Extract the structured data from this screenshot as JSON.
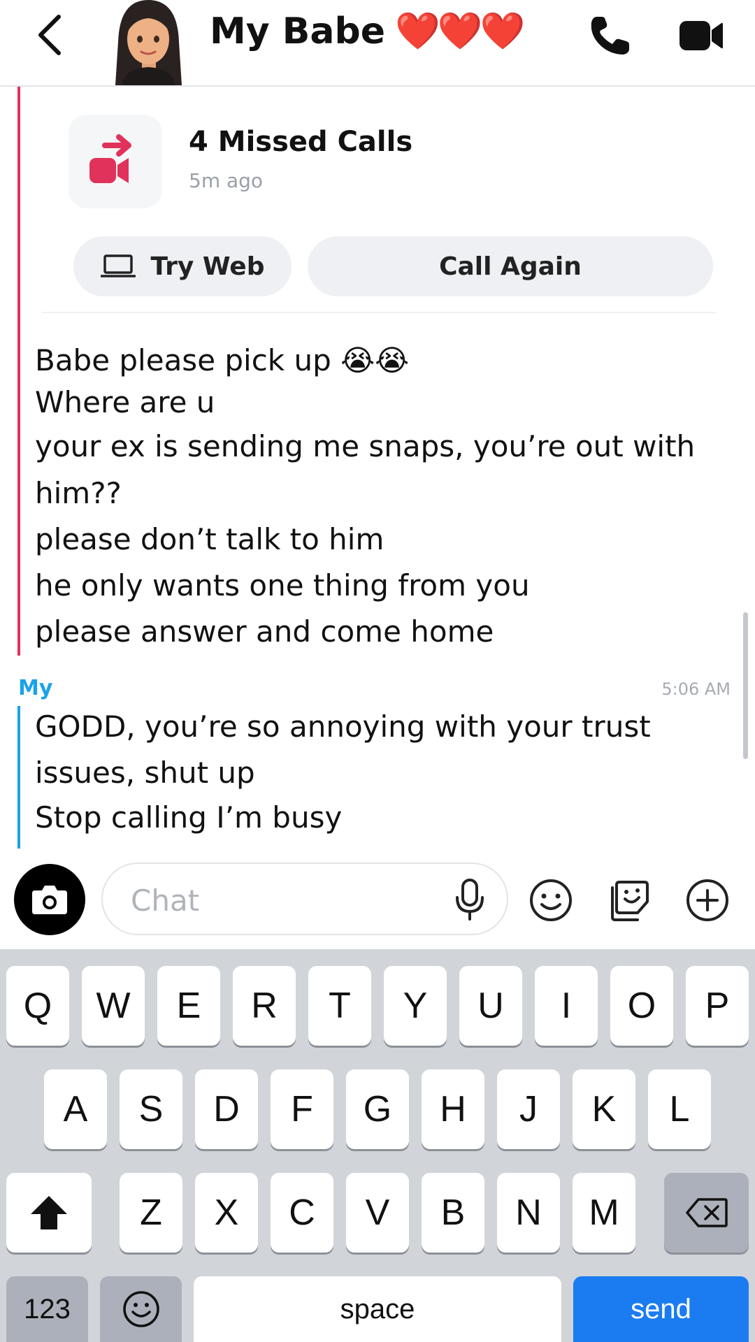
{
  "header": {
    "contact_name": "My Babe",
    "hearts": "❤️❤️❤️",
    "back_icon": "chevron-left-icon",
    "call_icon": "phone-icon",
    "video_icon": "video-camera-icon"
  },
  "missed_call_card": {
    "title": "4 Missed Calls",
    "time_ago": "5m ago",
    "try_web_label": "Try Web",
    "call_again_label": "Call Again",
    "accent_color": "#e0325b"
  },
  "messages_from_contact": [
    "Babe please pick up 😭😭",
    "Where are u",
    "your ex is sending me snaps, you’re out with",
    "him??",
    "please don’t talk to him",
    "he only wants one thing from you",
    "please answer and come home"
  ],
  "my_messages": {
    "sender": "My",
    "time": "5:06 AM",
    "lines": [
      "GODD, you’re so annoying with your trust",
      "issues, shut up",
      "Stop calling I’m busy"
    ],
    "accent_color": "#1aa3e8"
  },
  "chat_bar": {
    "placeholder": "Chat",
    "camera_icon": "camera-icon",
    "mic_icon": "microphone-icon",
    "emoji_icon": "smiley-icon",
    "stickers_icon": "sticker-icon",
    "plus_icon": "plus-icon"
  },
  "keyboard": {
    "row1": [
      "Q",
      "W",
      "E",
      "R",
      "T",
      "Y",
      "U",
      "I",
      "O",
      "P"
    ],
    "row2": [
      "A",
      "S",
      "D",
      "F",
      "G",
      "H",
      "J",
      "K",
      "L"
    ],
    "row3": [
      "Z",
      "X",
      "C",
      "V",
      "B",
      "N",
      "M"
    ],
    "numbers_label": "123",
    "space_label": "space",
    "send_label": "send",
    "send_color": "#1a7cf0"
  }
}
